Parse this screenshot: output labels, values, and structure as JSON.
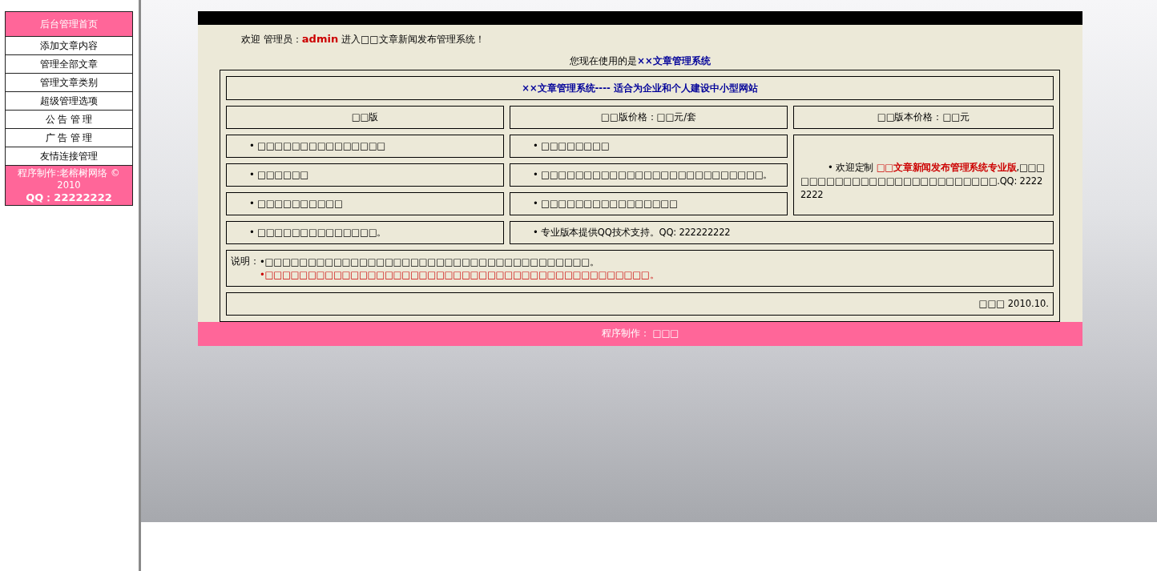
{
  "sidebar": {
    "title": "后台管理首页",
    "items": [
      "添加文章内容",
      "管理全部文章",
      "管理文章类别",
      "超级管理选项",
      "公 告 管 理",
      "广 告 管 理",
      "友情连接管理"
    ],
    "footer_lines": [
      "程序制作:老榕树网络 © 2010",
      "QQ：22222222"
    ]
  },
  "welcome": "欢迎 管理员：**admin** 进入□□文章新闻发布管理系统！",
  "using_line": "您现在使用的是**××文章管理系统**",
  "table": {
    "title": "××文章管理系统---- 适合为企业和个人建设中小型网站",
    "headers": [
      "□□版",
      "□□版价格：□□元/套",
      "□□版本价格：□□元"
    ],
    "feature_rows": [
      [
        "• □□□□□□□□□□□□□□□",
        "• □□□□□□□□"
      ],
      [
        "• □□□□□□",
        "• □□□□□□□□□□□□□□□□□□□□□□□□□□。"
      ],
      [
        "• □□□□□□□□□□",
        "• □□□□□□□□□□□□□□□□"
      ]
    ],
    "custom_cell": "• 欢迎定制 **□□文章新闻发布管理系统专业版**,□□□□□□□□□□□□□□□□□□□□□□□□□□.QQ: 22222222",
    "last_row": [
      "• □□□□□□□□□□□□□□。",
      "• 专业版本提供QQ技术支持。QQ: 222222222"
    ],
    "notes": {
      "label": "说明：",
      "lines": [
        {
          "text": "•□□□□□□□□□□□□□□□□□□□□□□□□□□□□□□□□□□□□□□。",
          "highlight": false
        },
        {
          "text": "•□□□□□□□□□□□□□□□□□□□□□□□□□□□□□□□□□□□□□□□□□□□□□。",
          "highlight": true
        }
      ]
    },
    "signature": "□□□  2010.10."
  },
  "footer": "程序制作： □□□"
}
